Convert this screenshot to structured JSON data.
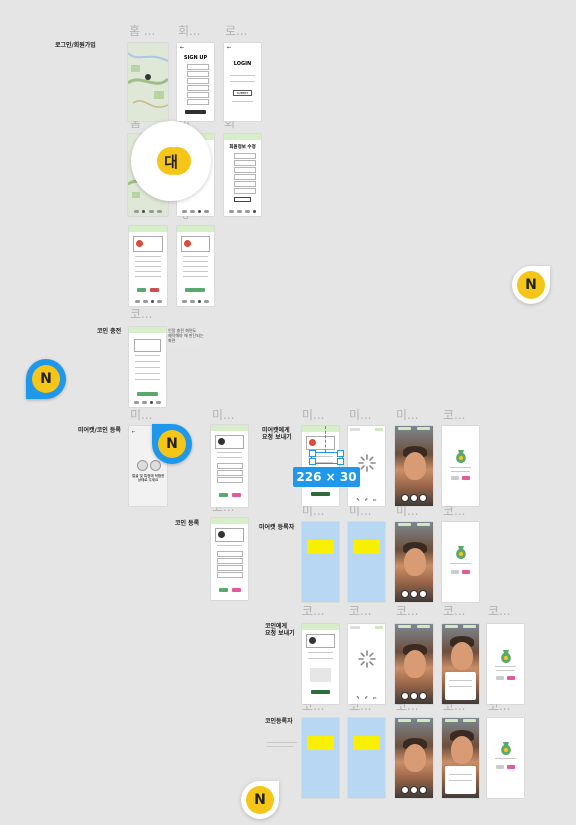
{
  "sections": {
    "login_signup": "로그인/회원가입",
    "coin_charge": "코인 충전",
    "meme_coin_register": "미어캣/코인 등록",
    "coin_register": "코인 등록",
    "meme_request": "미어캣에게\n요청 보내기",
    "meme_registrant": "미어캣 등록자",
    "coin_request": "코인에게\n요청 보내기",
    "coin_registrant": "코인등록자"
  },
  "frame_labels": {
    "home1": "홈 ...",
    "signup": "회...",
    "login": "로...",
    "home2": "홈",
    "mi": "미",
    "hoe2": "회",
    "ko_small": "ㅎ",
    "ko1": "코...",
    "mi1": "미...",
    "mi2": "미...",
    "mi3": "미...",
    "mi4": "미...",
    "mi5": "미...",
    "ko2": "코...",
    "ko3": "코...",
    "mi6": "미...",
    "mi7": "미...",
    "mi8": "미...",
    "ko4": "코...",
    "ko5": "코...",
    "ko6": "코...",
    "ko7": "코...",
    "ko8": "코...",
    "ko9": "코...",
    "ko10": "코...",
    "ko11": "코...",
    "ko12": "코...",
    "ko13": "코...",
    "ko14": "코..."
  },
  "screens": {
    "signup_title": "SIGN UP",
    "login_title": "LOGIN",
    "login_submit": "SUBMIT",
    "profile_edit_title": "회원정보 수정",
    "coin_charge_note": "인정 충전 화면도\n제작해야 해 판단되는\n화면",
    "meme_hint": "얼굴 및 특정에 적합한\n상태로 주세요"
  },
  "overlays": {
    "dimension_tag": "226 × 30",
    "avatar_big": "대",
    "avatar_n": "N"
  },
  "colors": {
    "canvas": "#e5e5e5",
    "header_green": "#d7efc8",
    "selection_blue": "#1f97ea",
    "avatar_yellow": "#f5c518",
    "highlight_yellow": "#f8f000",
    "light_blue": "#b7d7f3"
  }
}
